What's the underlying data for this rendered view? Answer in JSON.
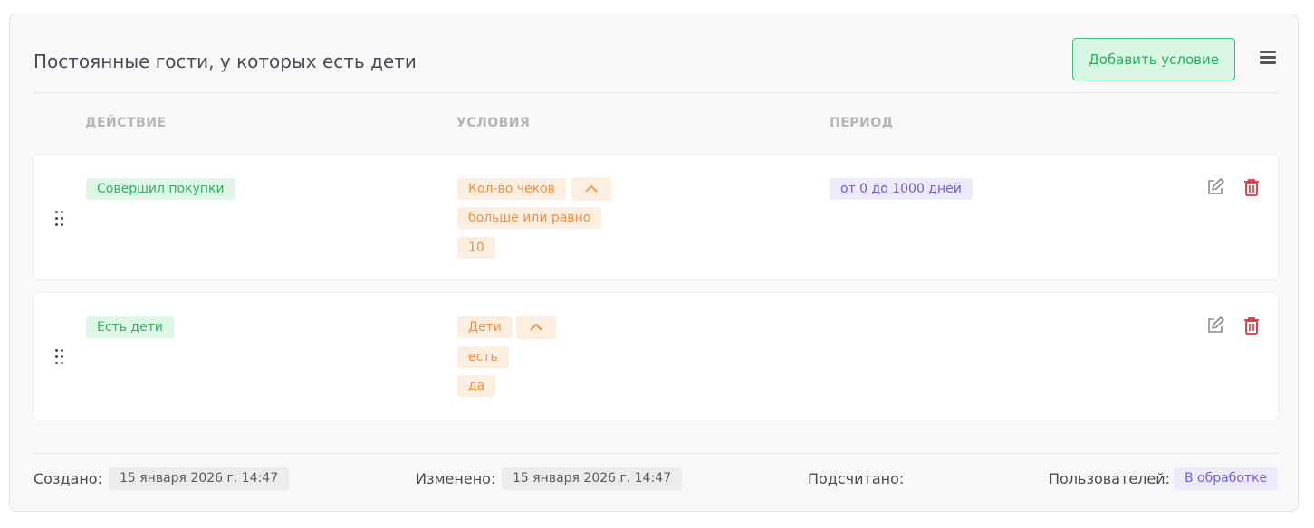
{
  "header": {
    "title": "Постоянные гости, у которых есть дети",
    "add_button_label": "Добавить условие",
    "menu_icon": "hamburger-menu-icon"
  },
  "table": {
    "columns": [
      "ДЕЙСТВИЕ",
      "УСЛОВИЯ",
      "ПЕРИОД"
    ],
    "rows": [
      {
        "action": "Совершил покупки",
        "conditions": {
          "field": "Кол-во чеков",
          "operator": "больше или равно",
          "value": "10"
        },
        "period": "от 0 до 1000 дней"
      },
      {
        "action": "Есть дети",
        "conditions": {
          "field": "Дети",
          "operator": "есть",
          "value": "да"
        },
        "period": ""
      }
    ]
  },
  "footer": {
    "created_label": "Создано:",
    "created_value": "15 января 2026 г. 14:47",
    "modified_label": "Изменено:",
    "modified_value": "15 января 2026 г. 14:47",
    "counted_label": "Подсчитано:",
    "users_label": "Пользователей:",
    "users_value": "В обработке"
  },
  "colors": {
    "accent_green": "#2eb35f",
    "accent_orange": "#f0913f",
    "accent_purple": "#6a5fd6",
    "delete_red": "#d9363e"
  }
}
